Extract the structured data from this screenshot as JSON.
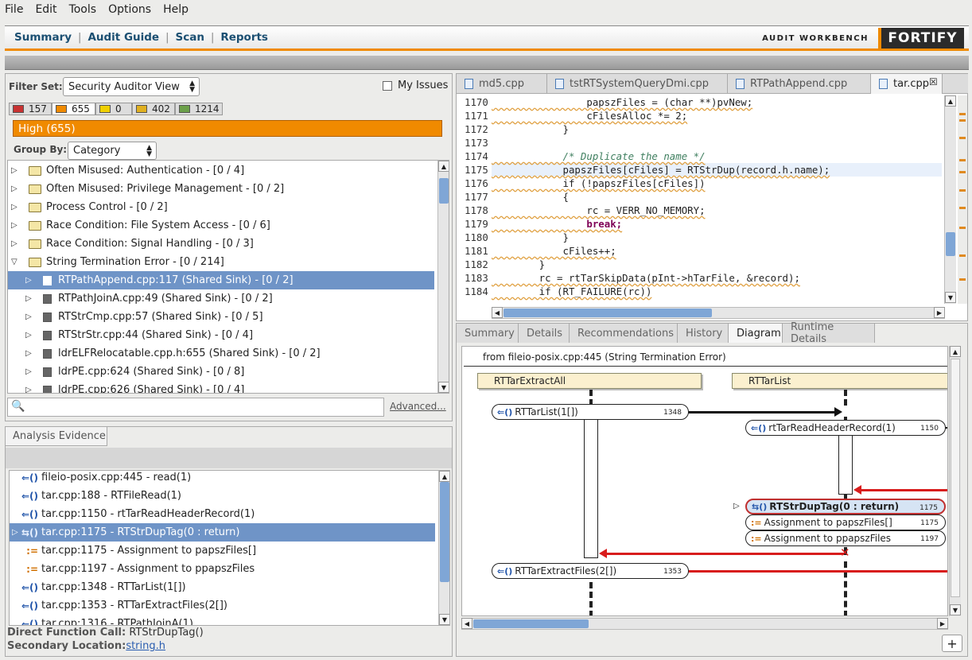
{
  "menu": [
    "File",
    "Edit",
    "Tools",
    "Options",
    "Help"
  ],
  "nav": {
    "items": [
      "Summary",
      "Audit Guide",
      "Scan",
      "Reports"
    ],
    "workbench_label": "AUDIT WORKBENCH",
    "logo": "FORTIFY"
  },
  "filter": {
    "label": "Filter Set:",
    "value": "Security Auditor View",
    "my_issues": "My Issues"
  },
  "counts": [
    {
      "value": "157",
      "color": "#c83232"
    },
    {
      "value": "655",
      "color": "#f08a00"
    },
    {
      "value": "0",
      "color": "#f0d000"
    },
    {
      "value": "402",
      "color": "#e0b020"
    },
    {
      "value": "1214",
      "color": "#6ca04a"
    }
  ],
  "high_bar": "High (655)",
  "group_by": {
    "label": "Group By:",
    "value": "Category"
  },
  "tree": [
    {
      "label": "Often Misused: Authentication - [0 / 4]",
      "type": "folder",
      "expanded": false
    },
    {
      "label": "Often Misused: Privilege Management - [0 / 2]",
      "type": "folder",
      "expanded": false
    },
    {
      "label": "Process Control - [0 / 2]",
      "type": "folder",
      "expanded": false
    },
    {
      "label": "Race Condition: File System Access - [0 / 6]",
      "type": "folder",
      "expanded": false
    },
    {
      "label": "Race Condition: Signal Handling - [0 / 3]",
      "type": "folder",
      "expanded": false
    },
    {
      "label": "String Termination Error - [0 / 214]",
      "type": "folder",
      "expanded": true
    },
    {
      "label": "RTPathAppend.cpp:117 (Shared Sink) - [0 / 2]",
      "type": "file",
      "selected": true
    },
    {
      "label": "RTPathJoinA.cpp:49 (Shared Sink) - [0 / 2]",
      "type": "file"
    },
    {
      "label": "RTStrCmp.cpp:57 (Shared Sink) - [0 / 5]",
      "type": "file"
    },
    {
      "label": "RTStrStr.cpp:44 (Shared Sink) - [0 / 4]",
      "type": "file"
    },
    {
      "label": "ldrELFRelocatable.cpp.h:655 (Shared Sink) - [0 / 2]",
      "type": "file"
    },
    {
      "label": "ldrPE.cpp:624 (Shared Sink) - [0 / 8]",
      "type": "file"
    },
    {
      "label": "ldrPE.cpp:626 (Shared Sink) - [0 / 4]",
      "type": "file"
    }
  ],
  "search": {
    "placeholder": "",
    "advanced": "Advanced..."
  },
  "evidence": {
    "tab": "Analysis Evidence",
    "rows": [
      {
        "icon": "⇐()",
        "label": "fileio-posix.cpp:445 - read(1)"
      },
      {
        "icon": "⇐()",
        "label": "tar.cpp:188 - RTFileRead(1)"
      },
      {
        "icon": "⇐()",
        "label": "tar.cpp:1150 - rtTarReadHeaderRecord(1)"
      },
      {
        "icon": "⇆()",
        "label": "tar.cpp:1175 - RTStrDupTag(0 : return)",
        "selected": true
      },
      {
        "icon": ":=",
        "label": "tar.cpp:1175 - Assignment to papszFiles[]"
      },
      {
        "icon": ":=",
        "label": "tar.cpp:1197 - Assignment to ppapszFiles"
      },
      {
        "icon": "⇐()",
        "label": "tar.cpp:1348 - RTTarList(1[])"
      },
      {
        "icon": "⇐()",
        "label": "tar.cpp:1353 - RTTarExtractFiles(2[])"
      },
      {
        "icon": "⇐()",
        "label": "tar.cpp:1316 - RTPathJoinA(1)"
      }
    ],
    "direct_label": "Direct Function Call:",
    "direct_value": "RTStrDupTag()",
    "secondary_label": "Secondary Location:",
    "secondary_value": "string.h"
  },
  "editor": {
    "tabs": [
      "md5.cpp",
      "tstRTSystemQueryDmi.cpp",
      "RTPathAppend.cpp",
      "tar.cpp"
    ],
    "lines": [
      {
        "n": "1170",
        "code": "                papszFiles = (char **)pvNew;"
      },
      {
        "n": "1171",
        "code": "                cFilesAlloc *= 2;"
      },
      {
        "n": "1172",
        "code": "            }"
      },
      {
        "n": "1173",
        "code": ""
      },
      {
        "n": "1174",
        "code": "            /* Duplicate the name */"
      },
      {
        "n": "1175",
        "code": "            papszFiles[cFiles] = RTStrDup(record.h.name);"
      },
      {
        "n": "1176",
        "code": "            if (!papszFiles[cFiles])"
      },
      {
        "n": "1177",
        "code": "            {"
      },
      {
        "n": "1178",
        "code": "                rc = VERR_NO_MEMORY;"
      },
      {
        "n": "1179",
        "code": "                break;"
      },
      {
        "n": "1180",
        "code": "            }"
      },
      {
        "n": "1181",
        "code": "            cFiles++;"
      },
      {
        "n": "1182",
        "code": "        }"
      },
      {
        "n": "1183",
        "code": "        rc = rtTarSkipData(pInt->hTarFile, &record);"
      },
      {
        "n": "1184",
        "code": "        if (RT_FAILURE(rc))"
      }
    ]
  },
  "details": {
    "tabs": [
      "Summary",
      "Details",
      "Recommendations",
      "History",
      "Diagram",
      "Runtime Details"
    ],
    "diagram": {
      "header": "from fileio-posix.cpp:445 (String Termination Error)",
      "lifelines": [
        "RTTarExtractAll",
        "RTTarList"
      ],
      "calls": [
        {
          "label": "RTTarList(1[])",
          "line": "1348"
        },
        {
          "label": "rtTarReadHeaderRecord(1)",
          "line": "1150"
        },
        {
          "label": "RTStrDupTag(0 : return)",
          "line": "1175"
        },
        {
          "label": "Assignment to papszFiles[]",
          "line": "1175"
        },
        {
          "label": "Assignment to ppapszFiles",
          "line": "1197"
        },
        {
          "label": "RTTarExtractFiles(2[])",
          "line": "1353"
        }
      ]
    },
    "add_button": "+"
  }
}
